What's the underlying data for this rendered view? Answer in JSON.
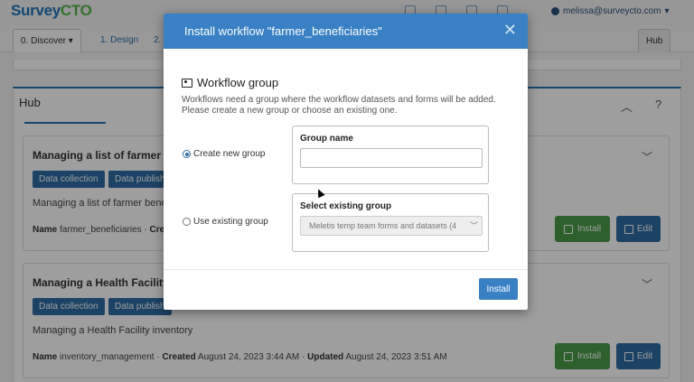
{
  "app": {
    "logo_part1": "Survey",
    "logo_part2": "CTO",
    "user_email": "melissa@surveycto.com",
    "user_chevron": "▾"
  },
  "tabs": [
    {
      "label": "0. Discover ▾"
    },
    {
      "label": "1. Design"
    },
    {
      "label": "2."
    },
    {
      "label": "Hub"
    }
  ],
  "hub": {
    "title": "Hub",
    "collapse_icon": "︿",
    "help_icon": "?",
    "cards": [
      {
        "title": "Managing a list of farmer b",
        "tags": [
          "Data collection",
          "Data publish"
        ],
        "description": "Managing a list of farmer bene",
        "meta_name_label": "Name",
        "meta_name_value": "farmer_beneficiaries",
        "meta_created_label": "Cre",
        "install_label": "Install",
        "edit_label": "Edit"
      },
      {
        "title": "Managing a Health Facility",
        "tags": [
          "Data collection",
          "Data publish"
        ],
        "description": "Managing a Health Facility inventory",
        "meta_name_label": "Name",
        "meta_name_value": "inventory_management",
        "meta_created_label": "Created",
        "meta_created_value": "August 24, 2023 3:44 AM",
        "meta_updated_label": "Updated",
        "meta_updated_value": "August 24, 2023 3:51 AM",
        "install_label": "Install",
        "edit_label": "Edit"
      }
    ]
  },
  "modal": {
    "title": "Install workflow \"farmer_beneficiaries\"",
    "close_icon": "✕",
    "section_title": "Workflow group",
    "section_desc": "Workflows need a group where the workflow datasets and forms will be added. Please create a new group or choose an existing one.",
    "option_new_label": "Create new group",
    "option_existing_label": "Use existing group",
    "group_name_label": "Group name",
    "group_name_value": "",
    "existing_group_label": "Select existing group",
    "existing_group_selected": "Meletis temp team forms and datasets (4",
    "install_button": "Install"
  },
  "colors": {
    "primary": "#3a80c4",
    "install_green": "#4a9b4a",
    "tag_blue": "#2e6da4"
  }
}
